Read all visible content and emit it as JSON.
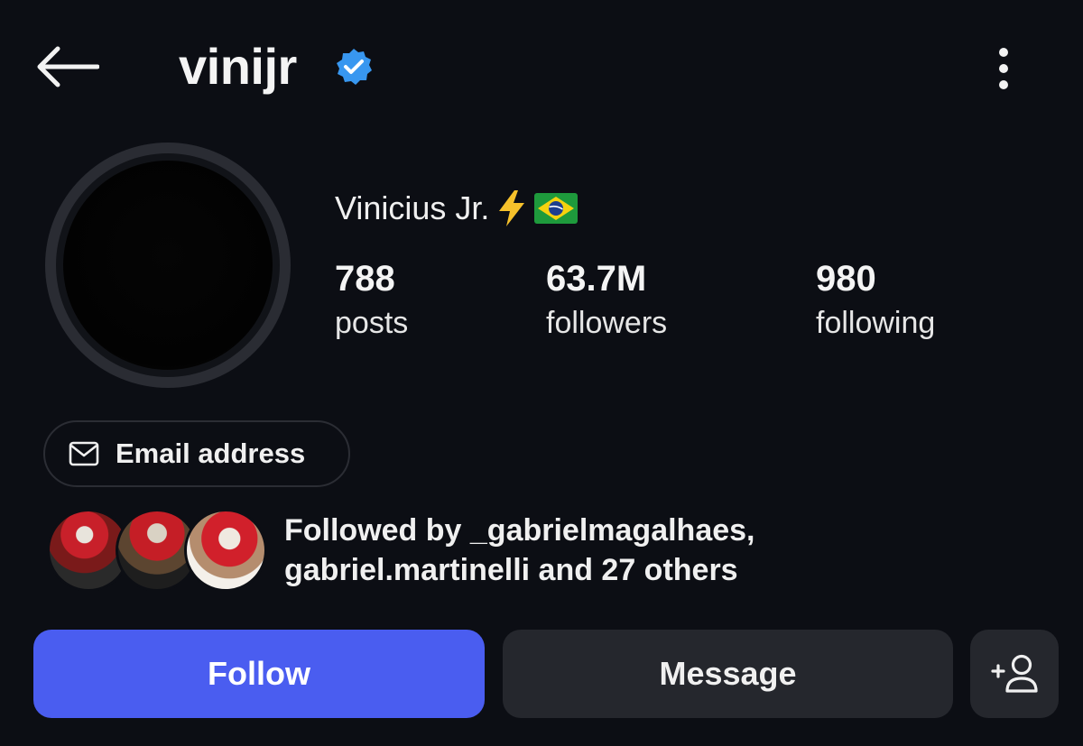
{
  "header": {
    "back_icon": "arrow-left-icon",
    "username": "vinijr",
    "verified_icon": "verified-badge-icon",
    "more_icon": "more-vertical-icon"
  },
  "profile": {
    "display_name": "Vinicius Jr.",
    "name_emojis": [
      "lightning-emoji",
      "brazil-flag-emoji"
    ],
    "stats": {
      "posts": {
        "value": "788",
        "label": "posts"
      },
      "followers": {
        "value": "63.7M",
        "label": "followers"
      },
      "following": {
        "value": "980",
        "label": "following"
      }
    }
  },
  "contact": {
    "email_icon": "envelope-icon",
    "email_label": "Email address"
  },
  "followed_by": {
    "line1": "Followed by _gabrielmagalhaes,",
    "line2": "gabriel.martinelli and 27 others"
  },
  "actions": {
    "follow_label": "Follow",
    "message_label": "Message",
    "suggest_icon": "add-person-icon"
  },
  "colors": {
    "background": "#0c0e14",
    "follow_button": "#4a5df0",
    "secondary_button": "#25272d",
    "verified_blue": "#3897f0"
  }
}
